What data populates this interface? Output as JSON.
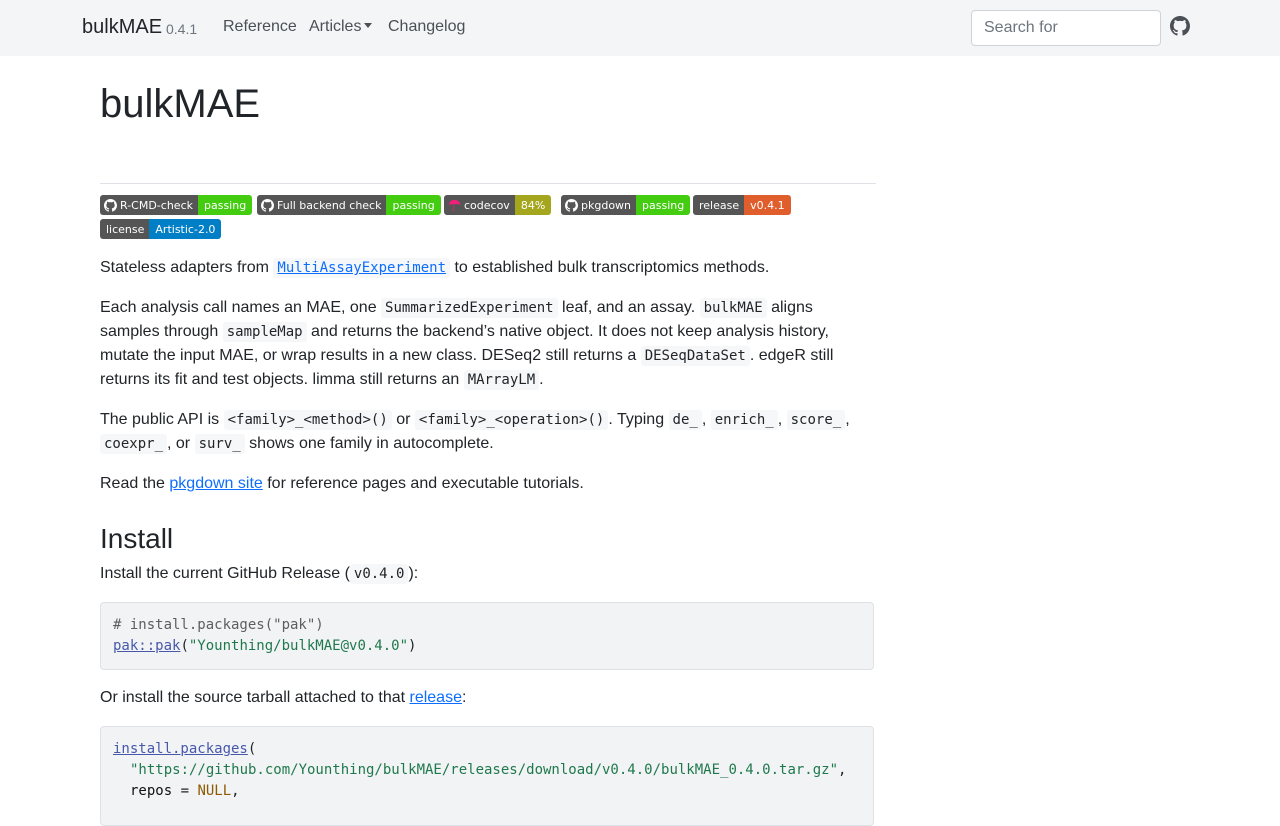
{
  "navbar": {
    "brand": "bulkMAE",
    "version": "0.4.1",
    "links": [
      "Reference",
      "Articles",
      "Changelog"
    ],
    "search_placeholder": "Search for",
    "github_icon": "github-icon"
  },
  "page": {
    "title": "bulkMAE",
    "badges": [
      {
        "left": "R-CMD-check",
        "right": "passing",
        "icon": "github-icon",
        "color": "#4c1"
      },
      {
        "left": "Full backend check",
        "right": "passing",
        "icon": "github-icon",
        "color": "#4c1"
      },
      {
        "left": "codecov",
        "right": "84%",
        "icon": "codecov-icon",
        "color": "#a4a61d"
      },
      {
        "left": "pkgdown",
        "right": "passing",
        "icon": "github-icon",
        "color": "#4c1"
      },
      {
        "left": "release",
        "right": "v0.4.1",
        "icon": "",
        "color": "#e05d2c"
      },
      {
        "left": "license",
        "right": "Artistic-2.0",
        "icon": "",
        "color": "#007ec6"
      }
    ],
    "intro": {
      "p1_a": "Stateless adapters from ",
      "p1_link": "MultiAssayExperiment",
      "p1_b": " to established bulk transcriptomics methods.",
      "p2_a": "Each analysis call names an MAE, one ",
      "p2_c1": "SummarizedExperiment",
      "p2_b": " leaf, and an assay. ",
      "p2_c2": "bulkMAE",
      "p2_c": " aligns samples through ",
      "p2_c3": "sampleMap",
      "p2_d": " and returns the backend’s native object. It does not keep analysis history, mutate the input MAE, or wrap results in a new class. DESeq2 still returns a ",
      "p2_c4": "DESeqDataSet",
      "p2_e": ". edgeR still returns its fit and test objects. limma still returns an ",
      "p2_c5": "MArrayLM",
      "p2_f": ".",
      "p3_a": "The public API is ",
      "p3_c1": "<family>_<method>()",
      "p3_b": " or ",
      "p3_c2": "<family>_<operation>()",
      "p3_c": ". Typing ",
      "p3_c3": "de_",
      "p3_sep1": ", ",
      "p3_c4": "enrich_",
      "p3_sep2": ", ",
      "p3_c5": "score_",
      "p3_sep3": ", ",
      "p3_c6": "coexpr_",
      "p3_d": ", or ",
      "p3_c7": "surv_",
      "p3_e": " shows one family in autocomplete.",
      "p4_a": "Read the ",
      "p4_link": "pkgdown site",
      "p4_b": " for reference pages and executable tutorials."
    },
    "install": {
      "heading": "Install",
      "p1_a": "Install the current GitHub Release (",
      "p1_code": "v0.4.0",
      "p1_b": "):",
      "code1_comment": "# install.packages(\"pak\")",
      "code1_fn": "pak::pak",
      "code1_open": "(",
      "code1_str": "\"Younthing/bulkMAE@v0.4.0\"",
      "code1_close": ")",
      "p2_a": "Or install the source tarball attached to that ",
      "p2_link": "release",
      "p2_b": ":",
      "code2_fn": "install.packages",
      "code2_open": "(",
      "code2_str": "\"https://github.com/Younthing/bulkMAE/releases/download/v0.4.0/bulkMAE_0.4.0.tar.gz\"",
      "code2_comma": ",",
      "code2_arg": "repos",
      "code2_eq": " = ",
      "code2_null": "NULL",
      "code2_comma2": ","
    }
  }
}
